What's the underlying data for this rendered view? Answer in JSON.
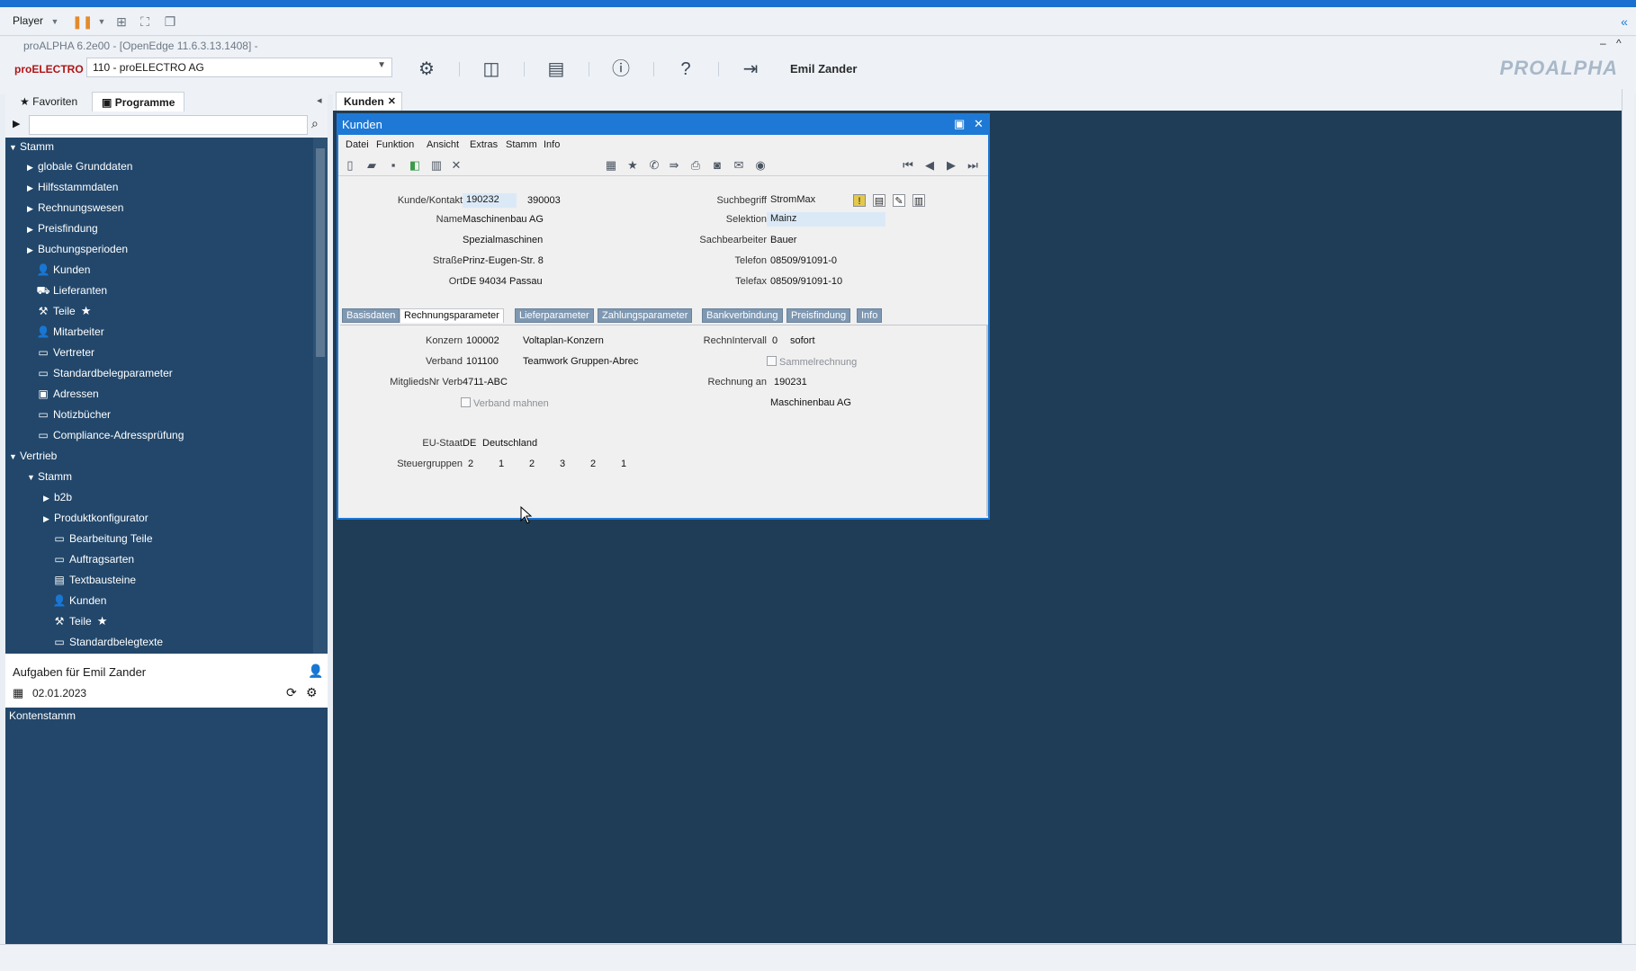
{
  "player": {
    "label": "Player"
  },
  "title": "proALPHA 6.2e00 - [OpenEdge 11.6.3.13.1408] -",
  "toolbar": {
    "mandant": "110 - proELECTRO AG",
    "user": "Emil Zander",
    "logo_left": "proELECTRO",
    "logo_right": "PROALPHA"
  },
  "left": {
    "tab_favoriten": "Favoriten",
    "tab_programme": "Programme",
    "search_placeholder": "",
    "tree": {
      "stamm": "Stamm",
      "globale": "globale Grunddaten",
      "hilfs": "Hilfsstammdaten",
      "rechnung": "Rechnungswesen",
      "preis": "Preisfindung",
      "buchung": "Buchungsperioden",
      "kunden": "Kunden",
      "lieferanten": "Lieferanten",
      "teile": "Teile",
      "mitarbeiter": "Mitarbeiter",
      "vertreter": "Vertreter",
      "standardbeleg": "Standardbelegparameter",
      "adressen": "Adressen",
      "notiz": "Notizbücher",
      "compliance": "Compliance-Adressprüfung",
      "vertrieb": "Vertrieb",
      "stamm2": "Stamm",
      "b2b": "b2b",
      "produkt": "Produktkonfigurator",
      "bearbeitung": "Bearbeitung Teile",
      "auftrag": "Auftragsarten",
      "textbaustein": "Textbausteine",
      "kunden2": "Kunden",
      "teile2": "Teile",
      "standardtexte": "Standardbelegtexte"
    },
    "tasks_title": "Aufgaben für Emil Zander",
    "tasks_date": "02.01.2023",
    "task_item": "Kontenstamm"
  },
  "main": {
    "tab": "Kunden"
  },
  "dialog": {
    "title": "Kunden",
    "menu": [
      "Datei",
      "Funktion",
      "Ansicht",
      "Extras",
      "Stamm",
      "Info"
    ],
    "header": {
      "kunde_label": "Kunde/Kontakt",
      "kunde": "190232",
      "kontakt": "390003",
      "name_label": "Name",
      "name": "Maschinenbau AG",
      "name2": "Spezialmaschinen",
      "strasse_label": "Straße",
      "strasse": "Prinz-Eugen-Str. 8",
      "ort_label": "Ort",
      "ort": "DE 94034 Passau",
      "such_label": "Suchbegriff",
      "such": "StromMax",
      "sel_label": "Selektion",
      "sel": "Mainz",
      "sach_label": "Sachbearbeiter",
      "sach": "Bauer",
      "tel_label": "Telefon",
      "tel": "08509/91091-0",
      "fax_label": "Telefax",
      "fax": "08509/91091-10"
    },
    "tabs": [
      "Basisdaten",
      "Rechnungsparameter",
      "Lieferparameter",
      "Zahlungsparameter",
      "Bankverbindung",
      "Preisfindung",
      "Info"
    ],
    "rp": {
      "konzern_label": "Konzern",
      "konzern": "100002",
      "konzern_name": "Voltaplan-Konzern",
      "verband_label": "Verband",
      "verband": "101100",
      "verband_name": "Teamwork Gruppen-Abrec",
      "mitglied_label": "MitgliedsNr Verb",
      "mitglied": "4711-ABC",
      "verband_mahnen": "Verband mahnen",
      "intervall_label": "RechnIntervall",
      "intervall": "0",
      "intervall_text": "sofort",
      "sammel": "Sammelrechnung",
      "rechnung_an_label": "Rechnung an",
      "rechnung_an": "190231",
      "rechnung_an_name": "Maschinenbau AG",
      "eu_label": "EU-Staat",
      "eu": "DE",
      "eu_name": "Deutschland",
      "steuer_label": "Steuergruppen",
      "steuer": [
        "2",
        "1",
        "2",
        "3",
        "2",
        "1"
      ]
    }
  },
  "colors": {
    "accent": "#1e79d6",
    "tree_bg": "#22476b",
    "desktop": "#1f3d57"
  }
}
